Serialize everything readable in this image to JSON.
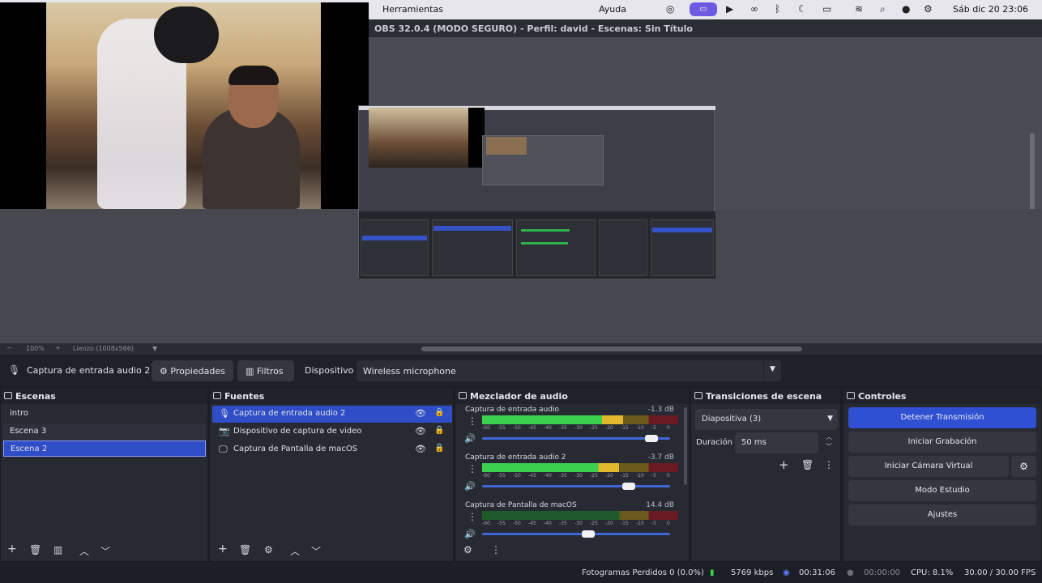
{
  "menubar": {
    "menu_items": [
      "Herramientas",
      "Ayuda"
    ],
    "clock": "Sáb dic 20  23:06",
    "colors": {
      "background": "#e7e6ec",
      "highlight": "#6c5be0"
    }
  },
  "window": {
    "title": "OBS 32.0.4 (MODO SEGURO) - Perfil: david - Escenas: Sin Título"
  },
  "preview": {
    "zoom": "100%",
    "canvas_label": "Lienzo (1008x566)"
  },
  "properties_bar": {
    "source_name": "Captura de entrada audio 2",
    "properties_button": "Propiedades",
    "filters_button": "Filtros",
    "device_label": "Dispositivo",
    "device_value": "Wireless microphone"
  },
  "scenes": {
    "title": "Escenas",
    "items": [
      {
        "label": "intro",
        "selected": false
      },
      {
        "label": "Escena 3",
        "selected": false
      },
      {
        "label": "Escena 2",
        "selected": true
      }
    ]
  },
  "sources": {
    "title": "Fuentes",
    "items": [
      {
        "label": "Captura de entrada audio 2",
        "icon": "microphone-icon",
        "selected": true
      },
      {
        "label": "Dispositivo de captura de video",
        "icon": "camera-icon",
        "selected": false
      },
      {
        "label": "Captura de Pantalla de macOS",
        "icon": "monitor-icon",
        "selected": false
      }
    ]
  },
  "mixer": {
    "title": "Mezclador de audio",
    "ticks": [
      "-60",
      "-55",
      "-50",
      "-45",
      "-40",
      "-35",
      "-30",
      "-25",
      "-20",
      "-15",
      "-10",
      "-5",
      "0"
    ],
    "channels": [
      {
        "name": "Captura de entrada audio",
        "db": "-1.3 dB",
        "level": 0.72,
        "volume": 0.93
      },
      {
        "name": "Captura de entrada audio 2",
        "db": "-3.7 dB",
        "level": 0.7,
        "volume": 0.8
      },
      {
        "name": "Captura de Pantalla de macOS",
        "db": "14.4 dB",
        "level": 0.0,
        "volume": 0.57
      }
    ]
  },
  "transitions": {
    "title": "Transiciones de escena",
    "selected": "Diapositiva (3)",
    "duration_label": "Duración",
    "duration_value": "50 ms"
  },
  "controls": {
    "title": "Controles",
    "stop_stream": "Detener Transmisión",
    "start_record": "Iniciar Grabación",
    "virtual_cam": "Iniciar Cámara Virtual",
    "studio_mode": "Modo Estudio",
    "settings": "Ajustes",
    "accent": "#3050d2"
  },
  "status": {
    "dropped_frames": "Fotogramas Perdidos 0 (0.0%)",
    "bitrate": "5769 kbps",
    "stream_time": "00:31:06",
    "record_time": "00:00:00",
    "cpu": "CPU: 8.1%",
    "fps": "30.00 / 30.00 FPS"
  }
}
